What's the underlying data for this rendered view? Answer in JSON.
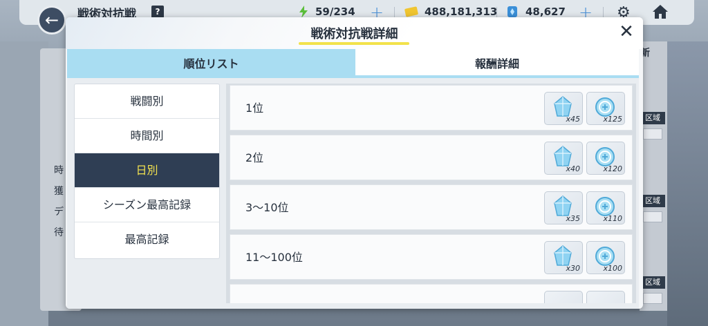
{
  "header": {
    "title": "戦術対抗戦",
    "help_label": "?",
    "ap": "59/234",
    "credits": "488,181,313",
    "gems": "48,627",
    "plus_label": "+"
  },
  "background": {
    "new_label": "新",
    "region_tag": "区域",
    "left_labels": [
      "時",
      "獲",
      "デ",
      "待"
    ]
  },
  "modal": {
    "title": "戦術対抗戦詳細",
    "close_label": "✕",
    "tabs": [
      {
        "label": "順位リスト",
        "active": true
      },
      {
        "label": "報酬詳細",
        "active": false
      }
    ],
    "sidebar": [
      {
        "label": "戦闘別",
        "active": false
      },
      {
        "label": "時間別",
        "active": false
      },
      {
        "label": "日別",
        "active": true
      },
      {
        "label": "シーズン最高記録",
        "active": false
      },
      {
        "label": "最高記録",
        "active": false
      }
    ],
    "rows": [
      {
        "rank": "1位",
        "gem_qty": "x45",
        "coin_qty": "x125"
      },
      {
        "rank": "2位",
        "gem_qty": "x40",
        "coin_qty": "x120"
      },
      {
        "rank": "3〜10位",
        "gem_qty": "x35",
        "coin_qty": "x110"
      },
      {
        "rank": "11〜100位",
        "gem_qty": "x30",
        "coin_qty": "x100"
      }
    ]
  },
  "colors": {
    "active_tab": "#a9ddf2",
    "active_sidebar": "#2f3e54",
    "active_sidebar_text": "#f4e34f",
    "title_underline": "#f2e24b"
  }
}
